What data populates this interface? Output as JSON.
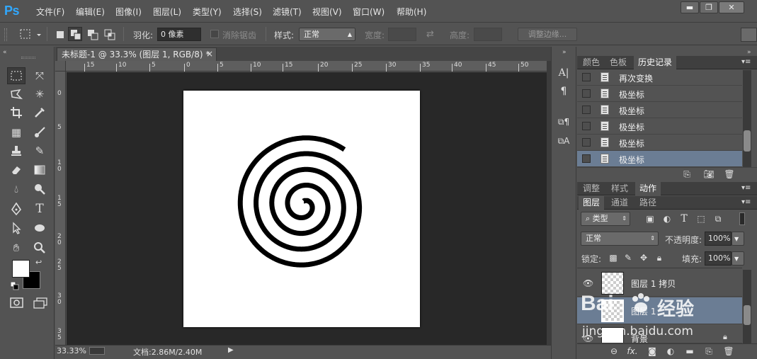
{
  "app": {
    "logo": "Ps"
  },
  "menu": [
    "文件(F)",
    "编辑(E)",
    "图像(I)",
    "图层(L)",
    "类型(Y)",
    "选择(S)",
    "滤镜(T)",
    "视图(V)",
    "窗口(W)",
    "帮助(H)"
  ],
  "window_controls": {
    "minimize": "▬",
    "restore": "❐",
    "close": "✕"
  },
  "options": {
    "feather_label": "羽化:",
    "feather_value": "0 像素",
    "antialias_label": "消除锯齿",
    "style_label": "样式:",
    "style_value": "正常",
    "width_label": "宽度:",
    "height_label": "高度:",
    "refine_edge": "调整边缘..."
  },
  "document": {
    "tab_title": "未标题-1 @ 33.3% (图层 1, RGB/8) *",
    "close": "×",
    "zoom": "33.33%",
    "doc_size": "文档:2.86M/2.40M"
  },
  "rulers": {
    "h": [
      "15",
      "10",
      "5",
      "0",
      "5",
      "10",
      "15",
      "20",
      "25",
      "30",
      "35",
      "40",
      "45",
      "50"
    ],
    "v": [
      "0",
      "5",
      "1 0",
      "1 5",
      "2 0",
      "2 5",
      "3 0",
      "3 5"
    ]
  },
  "panel_top": {
    "tabs": [
      "颜色",
      "色板",
      "历史记录"
    ],
    "active_tab": 2,
    "history": [
      {
        "label": "再次变换",
        "selected": false
      },
      {
        "label": "极坐标",
        "selected": false
      },
      {
        "label": "极坐标",
        "selected": false
      },
      {
        "label": "极坐标",
        "selected": false
      },
      {
        "label": "极坐标",
        "selected": false
      },
      {
        "label": "极坐标",
        "selected": true
      }
    ]
  },
  "panel_mid": {
    "tabs": [
      "调整",
      "样式",
      "动作"
    ],
    "active_tab": 2
  },
  "layers_panel": {
    "tabs": [
      "图层",
      "通道",
      "路径"
    ],
    "active_tab": 0,
    "filter_kind": "类型",
    "blend_mode": "正常",
    "opacity_label": "不透明度:",
    "opacity_value": "100%",
    "lock_label": "锁定:",
    "fill_label": "填充:",
    "fill_value": "100%",
    "layers": [
      {
        "name": "图层 1 拷贝",
        "selected": false
      },
      {
        "name": "图层 1",
        "selected": true
      },
      {
        "name": "背景",
        "selected": false
      }
    ],
    "bottom_icons": [
      "link-icon",
      "fx-icon",
      "mask-icon",
      "adjustment-icon",
      "folder-icon",
      "new-layer-icon",
      "trash-icon"
    ],
    "fx_text": "fx."
  },
  "watermark": {
    "brand": "Bai",
    "brand2": "经验",
    "url": "jingyan.baidu.com"
  },
  "colors": {
    "ui_bg": "#535353",
    "canvas_bg": "#282828",
    "selection": "#6b7d94",
    "ps_blue": "#31a8ff",
    "foreground": "#ffffff",
    "background": "#000000"
  }
}
